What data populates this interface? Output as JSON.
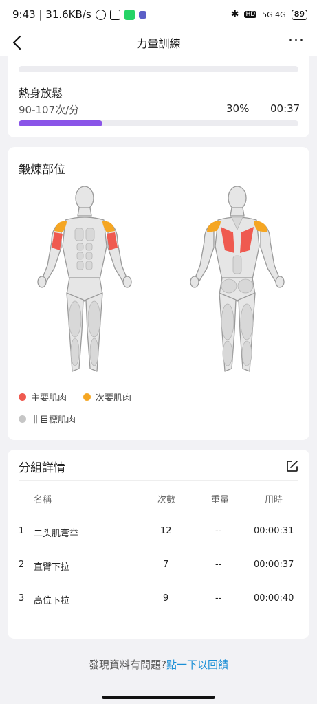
{
  "status_bar": {
    "time_speed": "9:43 | 31.6KB/s",
    "network": "5G 4G",
    "battery": "89"
  },
  "nav": {
    "title": "力量訓練",
    "more": "···"
  },
  "warmup": {
    "title": "熱身放鬆",
    "heart_rate_range": "90-107次/分",
    "percent_text": "30%",
    "duration": "00:37",
    "progress_fraction": 0.3
  },
  "muscles": {
    "title": "鍛煉部位",
    "legend": {
      "primary": "主要肌肉",
      "secondary": "次要肌肉",
      "non_target": "非目標肌肉"
    },
    "colors": {
      "primary": "#ef5a50",
      "secondary": "#f5a623",
      "non_target": "#c6c6c6"
    }
  },
  "sets": {
    "title": "分組詳情",
    "columns": [
      "名稱",
      "次數",
      "重量",
      "用時"
    ],
    "rows": [
      {
        "index": "1",
        "name": "二头肌弯举",
        "reps": "12",
        "weight": "--",
        "time": "00:00:31"
      },
      {
        "index": "2",
        "name": "直臂下拉",
        "reps": "7",
        "weight": "--",
        "time": "00:00:37"
      },
      {
        "index": "3",
        "name": "高位下拉",
        "reps": "9",
        "weight": "--",
        "time": "00:00:40"
      }
    ]
  },
  "feedback": {
    "prompt": "發現資料有問題?",
    "link": "點一下以回饋"
  },
  "accent_color": "#8a55e8"
}
